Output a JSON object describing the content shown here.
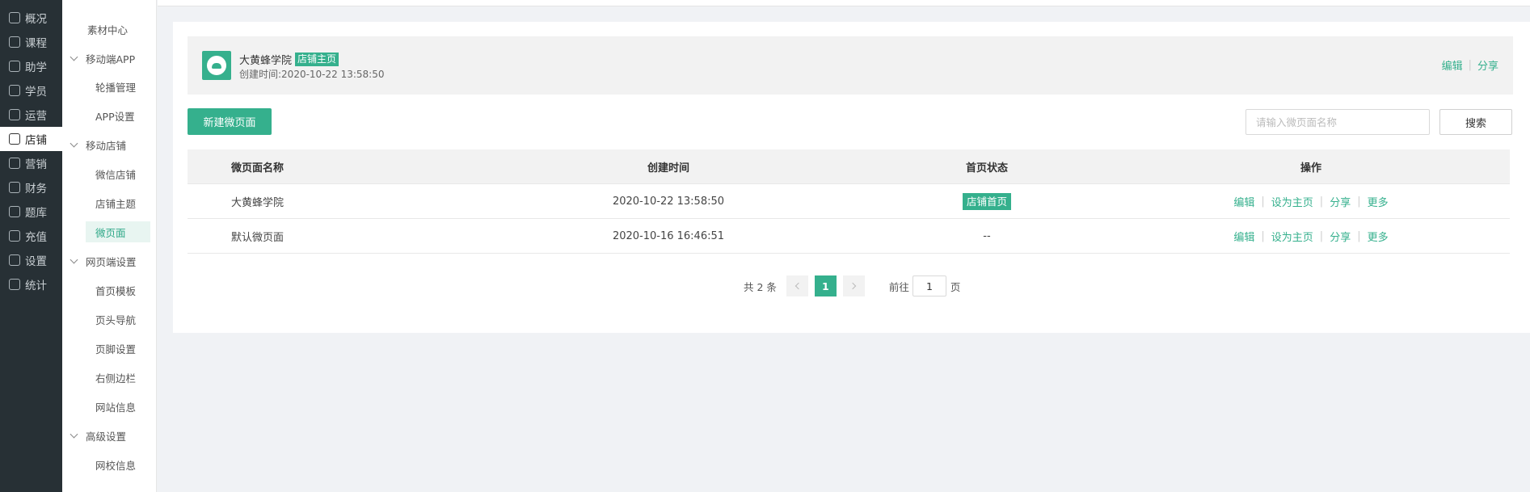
{
  "nav": {
    "items": [
      {
        "label": "概况",
        "icon": "chat-icon"
      },
      {
        "label": "课程",
        "icon": "book-icon"
      },
      {
        "label": "助学",
        "icon": "help-icon"
      },
      {
        "label": "学员",
        "icon": "user-icon"
      },
      {
        "label": "运营",
        "icon": "cube-icon"
      },
      {
        "label": "店铺",
        "icon": "store-icon"
      },
      {
        "label": "营销",
        "icon": "tag-icon"
      },
      {
        "label": "财务",
        "icon": "wallet-icon"
      },
      {
        "label": "题库",
        "icon": "pen-icon"
      },
      {
        "label": "充值",
        "icon": "coin-icon"
      },
      {
        "label": "设置",
        "icon": "gear-icon"
      },
      {
        "label": "统计",
        "icon": "bar-chart-icon"
      }
    ],
    "active": "店铺"
  },
  "submenu": {
    "top": "素材中心",
    "groups": [
      {
        "label": "移动端APP",
        "items": [
          "轮播管理",
          "APP设置"
        ]
      },
      {
        "label": "移动店铺",
        "items": [
          "微信店铺",
          "店铺主题",
          "微页面"
        ]
      },
      {
        "label": "网页端设置",
        "items": [
          "首页模板",
          "页头导航",
          "页脚设置",
          "右侧边栏",
          "网站信息"
        ]
      },
      {
        "label": "高级设置",
        "items": [
          "网校信息"
        ]
      }
    ],
    "active": "微页面"
  },
  "store": {
    "name": "大黄蜂学院",
    "badge": "店铺主页",
    "created": "创建时间:2020-10-22 13:58:50",
    "edit": "编辑",
    "share": "分享"
  },
  "toolbar": {
    "new_label": "新建微页面",
    "search_placeholder": "请输入微页面名称",
    "search_label": "搜索"
  },
  "table": {
    "headers": [
      "微页面名称",
      "创建时间",
      "首页状态",
      "操作"
    ],
    "rows": [
      {
        "name": "大黄蜂学院",
        "time": "2020-10-22 13:58:50",
        "status": "店铺首页",
        "status_badge": true
      },
      {
        "name": "默认微页面",
        "time": "2020-10-16 16:46:51",
        "status": "--",
        "status_badge": false
      }
    ],
    "ops": [
      "编辑",
      "设为主页",
      "分享",
      "更多"
    ]
  },
  "pager": {
    "total": "共 2 条",
    "current": "1",
    "goto": "前往",
    "goto_value": "1",
    "unit": "页"
  },
  "colors": {
    "accent": "#35b08d",
    "nav_bg": "#273035"
  }
}
